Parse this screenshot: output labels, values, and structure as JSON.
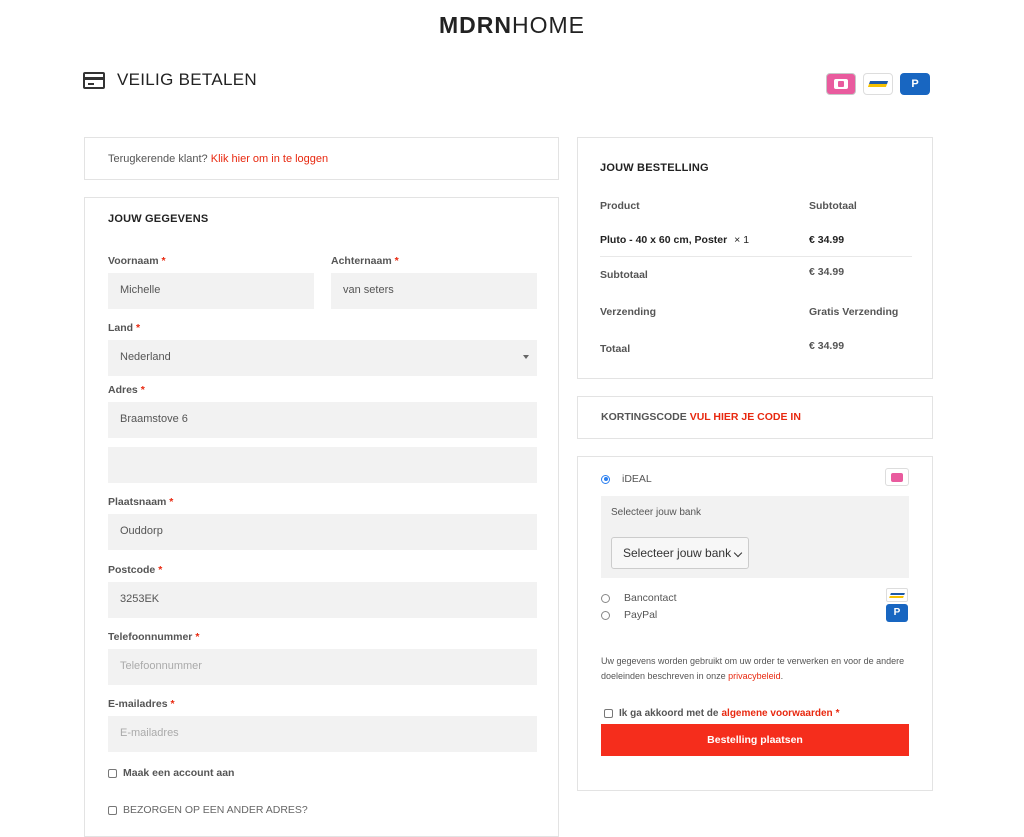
{
  "brand": {
    "bold": "MDRN",
    "light": "HOME"
  },
  "page_title": "VEILIG BETALEN",
  "login": {
    "text": "Terugkerende klant?",
    "link": "Klik hier om in te loggen"
  },
  "details": {
    "heading": "JOUW GEGEVENS",
    "voornaam": {
      "label": "Voornaam",
      "value": "Michelle"
    },
    "achternaam": {
      "label": "Achternaam",
      "value": "van seters"
    },
    "land": {
      "label": "Land",
      "value": "Nederland"
    },
    "adres": {
      "label": "Adres",
      "value": "Braamstove 6",
      "value2": ""
    },
    "plaatsnaam": {
      "label": "Plaatsnaam",
      "value": "Ouddorp"
    },
    "postcode": {
      "label": "Postcode",
      "value": "3253EK"
    },
    "telefoon": {
      "label": "Telefoonnummer",
      "placeholder": "Telefoonnummer"
    },
    "email": {
      "label": "E-mailadres",
      "placeholder": "E-mailadres"
    },
    "required": "*",
    "create_account": "Maak een account aan",
    "ship_elsewhere": "BEZORGEN OP EEN ANDER ADRES?"
  },
  "order": {
    "heading": "JOUW BESTELLING",
    "col_product": "Product",
    "col_subtotal": "Subtotaal",
    "item_name": "Pluto - 40 x 60 cm, Poster",
    "item_qty": "× 1",
    "item_price": "€ 34.99",
    "subtotal_label": "Subtotaal",
    "subtotal_value": "€ 34.99",
    "shipping_label": "Verzending",
    "shipping_value": "Gratis Verzending",
    "total_label": "Totaal",
    "total_value": "€ 34.99"
  },
  "coupon": {
    "text": "KORTINGSCODE",
    "link": "VUL HIER JE CODE IN"
  },
  "payment": {
    "ideal_label": "iDEAL",
    "bank_prompt": "Selecteer jouw bank",
    "bank_select": "Selecteer jouw bank",
    "bancontact_label": "Bancontact",
    "paypal_label": "PayPal",
    "privacy_text": "Uw gegevens worden gebruikt om uw order te verwerken en voor de andere doeleinden beschreven in onze",
    "privacy_link": "privacybeleid",
    "terms_text": "Ik ga akkoord met de",
    "terms_link": "algemene voorwaarden",
    "terms_star": "*",
    "submit": "Bestelling plaatsen"
  },
  "icons": [
    "card-icon",
    "ideal-icon",
    "bancontact-icon",
    "paypal-icon"
  ],
  "colors": {
    "accent": "#e8280f",
    "button": "#f52d1c",
    "radio": "#2a7ff0"
  }
}
